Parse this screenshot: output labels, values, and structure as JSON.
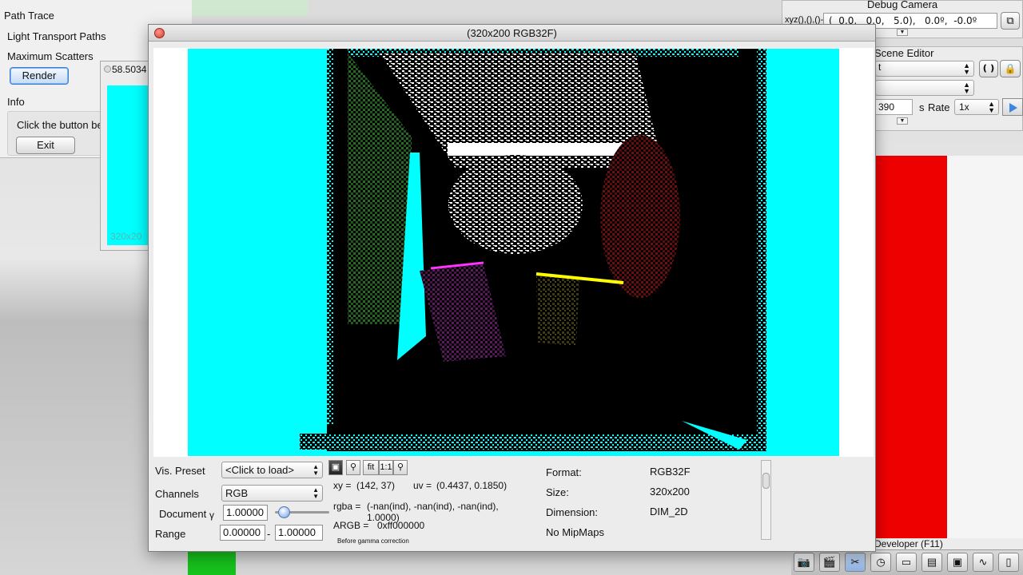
{
  "path_trace": {
    "title": "Path Trace",
    "light_transport_label": "Light Transport Paths",
    "max_scatters_label": "Maximum Scatters",
    "render_button": "Render",
    "info_label": "Info",
    "info_text": "Click the button be",
    "exit_button": "Exit"
  },
  "background_window": {
    "title": "58.5034",
    "label": "320x20"
  },
  "debug_camera": {
    "title": "Debug Camera",
    "xyz_label": "xyz(),(),()-",
    "value": "(  0.0,   0.0,   5.0),   0.0º,  -0.0º"
  },
  "scene_editor": {
    "title": "Scene Editor",
    "dropdown1": "t",
    "dropdown2": "",
    "time_value": "390",
    "time_unit": "s",
    "rate_label": "Rate",
    "rate_value": "1x"
  },
  "developer": {
    "label": "Developer (F11)"
  },
  "texture_window": {
    "title": "(320x200 RGB32F)",
    "vis_preset_label": "Vis. Preset",
    "vis_preset_value": "<Click to load>",
    "channels_label": "Channels",
    "channels_value": "RGB",
    "document_label": "Document",
    "gamma_symbol": "γ",
    "gamma_value": "1.00000",
    "range_label": "Range",
    "range_min": "0.00000",
    "range_sep": "-",
    "range_max": "1.00000",
    "fit_label": "fit",
    "one_to_one_label": "1:1",
    "xy_label": "xy =",
    "xy_value": "(142, 37)",
    "uv_label": "uv =",
    "uv_value": "(0.4437, 0.1850)",
    "rgba_label": "rgba =",
    "rgba_value": "(-nan(ind), -nan(ind), -nan(ind),",
    "rgba_value2": "1.0000)",
    "argb_label": "ARGB =",
    "argb_value": "0xff000000",
    "gamma_note": "Before gamma correction",
    "format_label": "Format:",
    "format_value": "RGB32F",
    "size_label": "Size:",
    "size_value": "320x200",
    "dimension_label": "Dimension:",
    "dimension_value": "DIM_2D",
    "mipmaps_text": "No MipMaps"
  },
  "colors": {
    "cyan": "#00ffff",
    "render_bg": "#000000",
    "accent_blue": "#3b86e0",
    "scene_red": "#ee0000"
  }
}
